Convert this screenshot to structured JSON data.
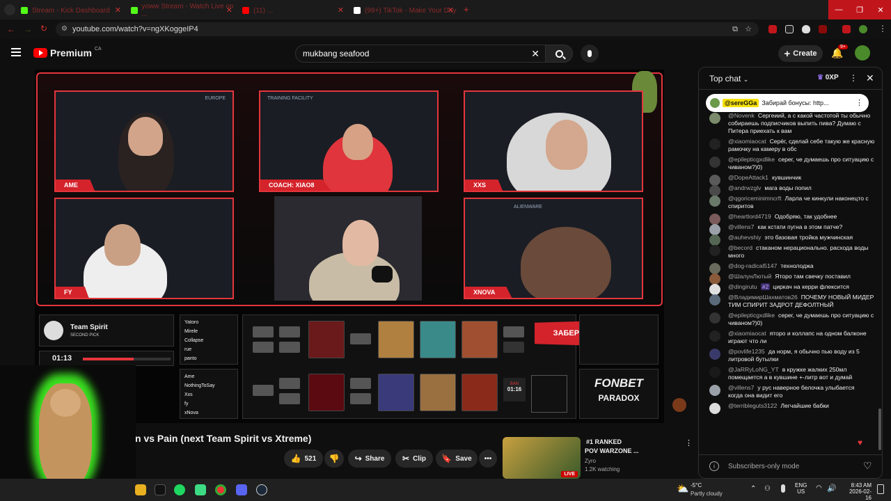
{
  "browser": {
    "tabs": [
      {
        "label": "Stream - Kick Dashboard",
        "color": "#53fc18"
      },
      {
        "label": "yoww Stream - Watch Live on ...",
        "color": "#53fc18"
      },
      {
        "label": "(11) ...",
        "color": "#ff0000"
      },
      {
        "label": "(99+) TikTok - Make Your Day",
        "color": "#ffffff"
      }
    ],
    "new_tab": "+",
    "url": "youtube.com/watch?v=ngXKoggeIP4"
  },
  "youtube": {
    "logo_text": "Premium",
    "region": "CA",
    "search_value": "mukbang seafood",
    "create_label": "Create",
    "notif_badge": "9+"
  },
  "video": {
    "cams": [
      {
        "label": "AME"
      },
      {
        "label": "COACH: XIAO8"
      },
      {
        "label": "XXS"
      },
      {
        "label": "FY"
      },
      {
        "label": ""
      },
      {
        "label": "XNOVA"
      }
    ],
    "europe_tag": "EUROPE",
    "facility_tag": "TRAINING FACILITY",
    "alienware": "ALIENWARE",
    "team": {
      "name": "Team Spirit",
      "pick": "SECOND PICK"
    },
    "timer": "01:13",
    "players_top": [
      "Yatoro",
      "Mirele",
      "Collapse",
      "rue",
      "panto"
    ],
    "players_bottom": [
      "Ame",
      "NothingToSay",
      "Xxs",
      "fy",
      "xNova"
    ],
    "ban_label": "BAN",
    "ban_timer": "01:16",
    "promo": "ЗАБЕРИ В TG",
    "sponsor1": "FONBET",
    "sponsor2": "PARADOX"
  },
  "below_video": {
    "title": "n vs Pain (next Team Spirit vs Xtreme)",
    "likes": "521",
    "share": "Share",
    "clip": "Clip",
    "save": "Save",
    "rec": {
      "title1": "#1 RANKED",
      "title2": "POV WARZONE ...",
      "channel": "Zyro",
      "watching": "1.2K watching",
      "live": "LIVE"
    }
  },
  "chat": {
    "header": "Top chat",
    "points": "0XP",
    "pinned": {
      "author": "@sereGGa",
      "text": "Забирай бонусы: http..."
    },
    "messages": [
      {
        "author": "@Novenk",
        "text": "Сергеиий, а с какой частотой ты обычно собираешь подписчиков выпить пива? Думаю с Питера приехать к вам",
        "color": "#7a8a6a"
      },
      {
        "author": "@xiaomiaocat",
        "text": "Серёг, сделай себе такую же красную рамочку на камеру в обс",
        "color": "#222222"
      },
      {
        "author": "@epilepticgxdlike",
        "text": "серег, че думаешь про ситуацию с чиваном?)0)",
        "color": "#333333"
      },
      {
        "author": "@DopeAttack1",
        "text": "кувшинчик",
        "color": "#5a5a5a"
      },
      {
        "author": "@andrwzglv",
        "text": "мага воды попил",
        "color": "#4a4a4a"
      },
      {
        "author": "@qgoriceminimncrft",
        "text": "Ларла че кинкули наконецто с спиритов",
        "color": "#6a7a6a"
      },
      {
        "author": "@heartlord4719",
        "text": "Одобряю, так удобнее",
        "color": "#7a5a5a"
      },
      {
        "author": "@villens7",
        "text": "как кстати пугна в этом патче?",
        "color": "#9aa0a8"
      },
      {
        "author": "@auhevshiy",
        "text": "это базовая тройка мужчинская",
        "color": "#556655"
      },
      {
        "author": "@becord",
        "text": "стаканом нерационально. расхода воды много",
        "color": "#222222"
      },
      {
        "author": "@dog-radical5147",
        "text": "технолоджа",
        "color": "#6a6a5a"
      },
      {
        "author": "@ШалунЛютый",
        "text": "Ятоpo там свечку поставил",
        "color": "#8a5a3a"
      },
      {
        "author": "@dingirutu",
        "text": "циркач на керри флексится",
        "color": "#e0e0e0",
        "badge": "#2"
      },
      {
        "author": "@ВладимирШахматов26",
        "text": "ПОЧЕМУ НОВЫЙ МИДЕР ТИМ СПИРИТ ЗАДРОТ ДЕФОЛТНЫЙ",
        "color": "#5a6a7a"
      },
      {
        "author": "@epilepticgxdlike",
        "text": "серег, че думаешь про ситуацию с чиваном?)0)",
        "color": "#333333"
      },
      {
        "author": "@xiaomiaocat",
        "text": "ятоpo и коллапс на одном балконе играют что ли",
        "color": "#222222"
      },
      {
        "author": "@povlife1235",
        "text": "да норм, я обычно пью воду из 5 литровой бутылки",
        "color": "#3a3a6a"
      },
      {
        "author": "@JaRRyLoNG_YT",
        "text": "в кружке жалких 250мл помещается а в кувшине +-литр вот и думай",
        "color": "#1a1a1a"
      },
      {
        "author": "@villens7",
        "text": "у рус наверное белочка улыбается",
        "suffix": "когда она видит его",
        "color": "#9aa0a8"
      },
      {
        "author": "@terribleguts3122",
        "text": "Легчайшие бабки",
        "color": "#dddddd"
      }
    ],
    "footer": "Subscribers-only mode"
  },
  "taskbar": {
    "weather_temp": "-5°C",
    "weather_desc": "Partly cloudy",
    "lang1": "ENG",
    "lang2": "US",
    "time": "8:43 AM",
    "date": "2026-02-16"
  }
}
